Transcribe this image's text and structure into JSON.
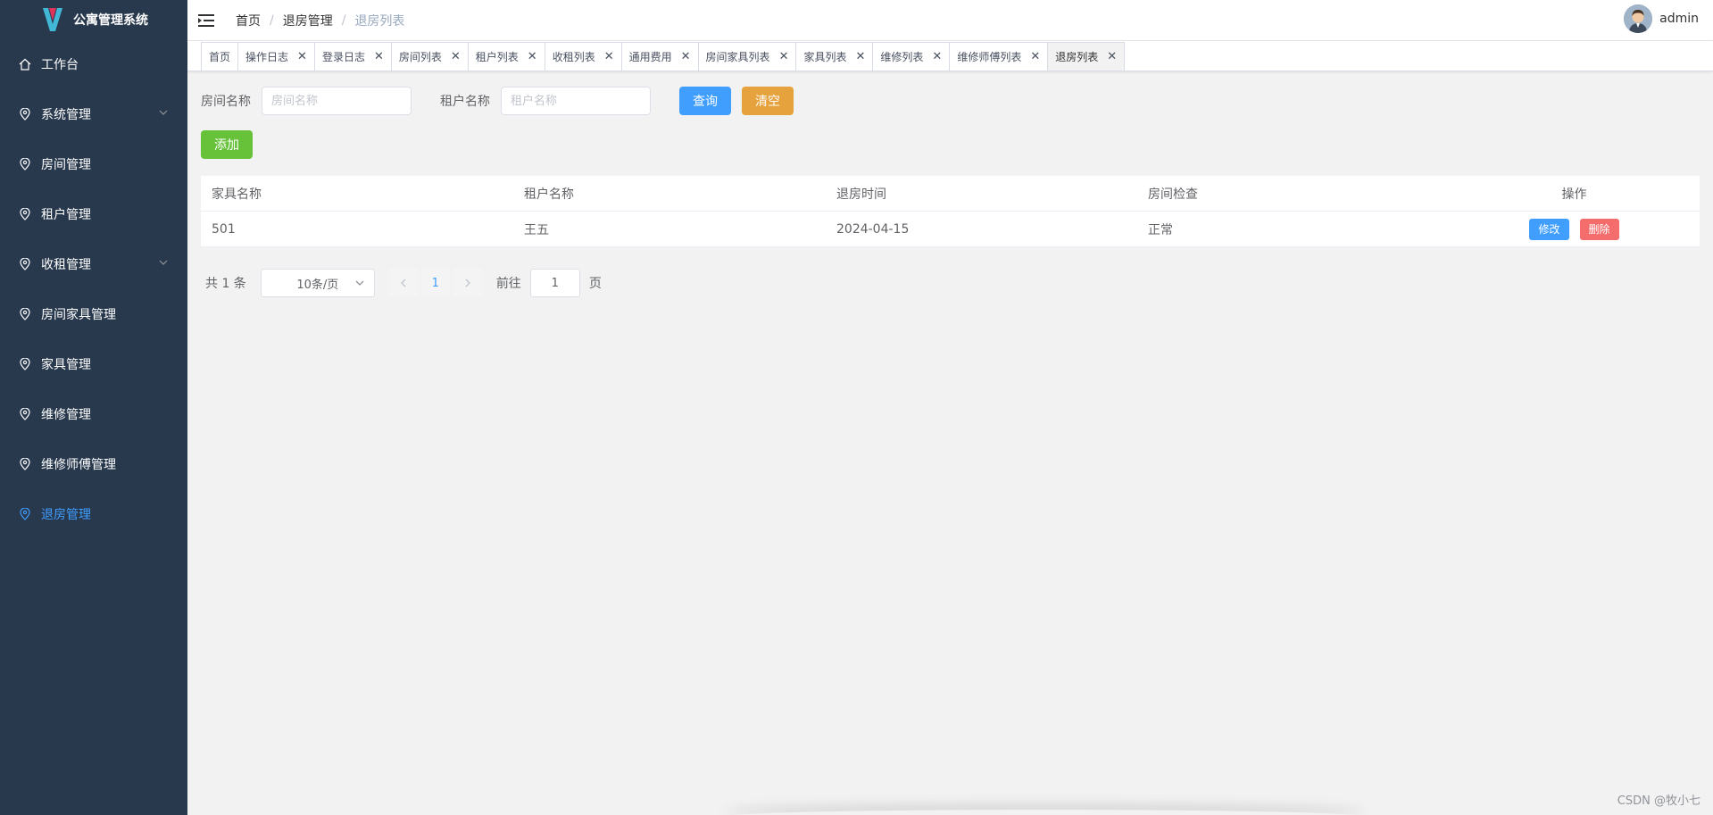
{
  "app": {
    "title": "公寓管理系统"
  },
  "sidebar": {
    "items": [
      {
        "label": "工作台",
        "icon": "home-icon",
        "expandable": false
      },
      {
        "label": "系统管理",
        "icon": "location-icon",
        "expandable": true
      },
      {
        "label": "房间管理",
        "icon": "location-icon",
        "expandable": false
      },
      {
        "label": "租户管理",
        "icon": "location-icon",
        "expandable": false
      },
      {
        "label": "收租管理",
        "icon": "location-icon",
        "expandable": true
      },
      {
        "label": "房间家具管理",
        "icon": "location-icon",
        "expandable": false
      },
      {
        "label": "家具管理",
        "icon": "location-icon",
        "expandable": false
      },
      {
        "label": "维修管理",
        "icon": "location-icon",
        "expandable": false
      },
      {
        "label": "维修师傅管理",
        "icon": "location-icon",
        "expandable": false
      },
      {
        "label": "退房管理",
        "icon": "location-icon",
        "expandable": false,
        "active": true
      }
    ]
  },
  "header": {
    "breadcrumb": [
      "首页",
      "退房管理",
      "退房列表"
    ],
    "separator": "/",
    "username": "admin"
  },
  "tabs": [
    {
      "label": "首页",
      "closable": false
    },
    {
      "label": "操作日志",
      "closable": true
    },
    {
      "label": "登录日志",
      "closable": true
    },
    {
      "label": "房间列表",
      "closable": true
    },
    {
      "label": "租户列表",
      "closable": true
    },
    {
      "label": "收租列表",
      "closable": true
    },
    {
      "label": "通用费用",
      "closable": true
    },
    {
      "label": "房间家具列表",
      "closable": true
    },
    {
      "label": "家具列表",
      "closable": true
    },
    {
      "label": "维修列表",
      "closable": true
    },
    {
      "label": "维修师傅列表",
      "closable": true
    },
    {
      "label": "退房列表",
      "closable": true,
      "active": true
    }
  ],
  "search": {
    "room_label": "房间名称",
    "room_placeholder": "房间名称",
    "tenant_label": "租户名称",
    "tenant_placeholder": "租户名称",
    "query_button": "查询",
    "clear_button": "清空",
    "add_button": "添加"
  },
  "table": {
    "columns": [
      "家具名称",
      "租户名称",
      "退房时间",
      "房间检查",
      "操作"
    ],
    "rows": [
      {
        "name": "501",
        "tenant": "王五",
        "time": "2024-04-15",
        "check": "正常"
      }
    ],
    "edit_button": "修改",
    "delete_button": "删除"
  },
  "pagination": {
    "total_text": "共 1 条",
    "page_size": "10条/页",
    "current_page": "1",
    "goto_label": "前往",
    "goto_value": "1",
    "page_suffix": "页"
  },
  "watermark": "CSDN @牧小七",
  "colors": {
    "sidebar_bg": "#28384d",
    "primary": "#409eff",
    "warning": "#e6a23c",
    "success": "#67c23a",
    "danger": "#f56c6c"
  }
}
